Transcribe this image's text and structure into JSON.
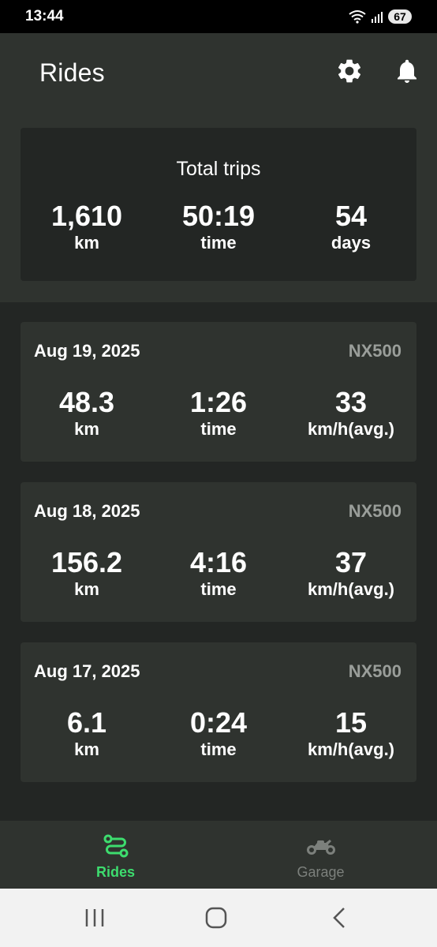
{
  "status": {
    "time": "13:44",
    "battery": "67"
  },
  "header": {
    "title": "Rides"
  },
  "icons": {
    "settings": "gear-icon",
    "notifications": "bell-icon"
  },
  "summary": {
    "title": "Total trips",
    "stats": [
      {
        "value": "1,610",
        "label": "km"
      },
      {
        "value": "50:19",
        "label": "time"
      },
      {
        "value": "54",
        "label": "days"
      }
    ]
  },
  "rides": [
    {
      "date": "Aug 19, 2025",
      "bike": "NX500",
      "stats": [
        {
          "value": "48.3",
          "label": "km"
        },
        {
          "value": "1:26",
          "label": "time"
        },
        {
          "value": "33",
          "label": "km/h(avg.)"
        }
      ]
    },
    {
      "date": "Aug 18, 2025",
      "bike": "NX500",
      "stats": [
        {
          "value": "156.2",
          "label": "km"
        },
        {
          "value": "4:16",
          "label": "time"
        },
        {
          "value": "37",
          "label": "km/h(avg.)"
        }
      ]
    },
    {
      "date": "Aug 17, 2025",
      "bike": "NX500",
      "stats": [
        {
          "value": "6.1",
          "label": "km"
        },
        {
          "value": "0:24",
          "label": "time"
        },
        {
          "value": "15",
          "label": "km/h(avg.)"
        }
      ]
    }
  ],
  "nav": {
    "items": [
      {
        "label": "Rides",
        "icon": "route-icon",
        "active": true
      },
      {
        "label": "Garage",
        "icon": "motorcycle-icon",
        "active": false
      }
    ]
  },
  "colors": {
    "accent": "#3ddc6e",
    "inactive": "#7c807c",
    "background": "#232624",
    "surface": "#2f332f"
  }
}
